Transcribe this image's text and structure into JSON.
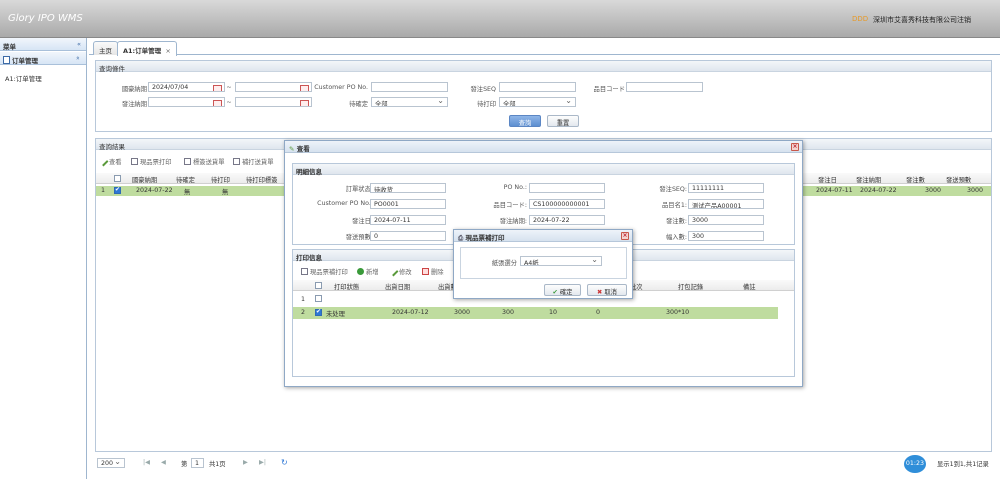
{
  "header": {
    "title": "Glory IPO WMS",
    "company": "深圳市艾喜秀科技有限公司",
    "logout": "注销",
    "dot": "DDD"
  },
  "sidebar": {
    "title": "菜单",
    "collapse": "«",
    "group": "订单管理",
    "group_toggle": "«",
    "link": "A1:订单管理"
  },
  "tabs": [
    {
      "label": "主页"
    },
    {
      "label": "A1:订单管理",
      "close": "×"
    }
  ],
  "query": {
    "title": "查询條件",
    "fields": {
      "order_date_label": "國豪納期",
      "order_date_from": "2024/07/04",
      "tilde1": "~",
      "po_label": "Customer PO No.",
      "seq_label": "發注SEQ",
      "item_code_label": "品目コード",
      "ship_date_label": "發注納期",
      "tilde2": "~",
      "confirm_label": "待確定",
      "confirm_value": "全部",
      "print_label": "待打印",
      "print_value": "全部"
    },
    "search_button": "查詢",
    "reset_button": "重置"
  },
  "results": {
    "title": "查詢結果",
    "toolbar": [
      "查看",
      "現品票打印",
      "標簽送貨單",
      "補打送貨單"
    ],
    "left_columns": [
      "國豪納期",
      "待確定",
      "待打印",
      "待打印標簽"
    ],
    "right_columns": [
      "發注日",
      "發注納期",
      "發注數",
      "發送預數"
    ],
    "row": {
      "num": "1",
      "date": "2024-07-22",
      "c1": "無",
      "c2": "無",
      "r1": "2024-07-11",
      "r2": "2024-07-22",
      "r3": "3000",
      "r4": "3000"
    }
  },
  "pager": {
    "size": "200",
    "page_label": "第",
    "page": "1",
    "total_label": "共1页",
    "info": "显示1到1,共1记录",
    "timer": "01:23"
  },
  "view_dialog": {
    "title": "查看",
    "detail_title": "明細信息",
    "labels": [
      "訂單状态:",
      "Customer PO No.:",
      "發注日:",
      "發送預數:",
      "PO No.:",
      "品目コード:",
      "發注納期:",
      "發注SEQ:",
      "品目名1:",
      "發注數:",
      "幅入數:"
    ],
    "values": {
      "status": "待收货",
      "customer_po": "PO0001",
      "order_date": "2024-07-11",
      "send_count": "0",
      "po_no": "",
      "item_code": "CS100000000001",
      "ship_date": "2024-07-22",
      "seq": "11111111",
      "item_name": "测试产品A00001",
      "qty": "3000",
      "box_qty": "300"
    },
    "print_title": "打印信息",
    "print_toolbar": [
      "現品票補打印",
      "新增",
      "修改",
      "删除"
    ],
    "print_columns": [
      "打印狀態",
      "出貨日期",
      "出貨數",
      "",
      "",
      "",
      "批次",
      "打包記錄",
      "備註"
    ],
    "print_rows": [
      {
        "num": "1",
        "status": "",
        "date": "",
        "qty": "",
        "c4": "",
        "c5": "",
        "c6": "",
        "batch": "",
        "record": "",
        "note": ""
      },
      {
        "num": "2",
        "status": "未处理",
        "date": "2024-07-12",
        "qty": "3000",
        "c4": "300",
        "c5": "10",
        "c6": "0",
        "batch": "",
        "record": "300*10",
        "note": ""
      }
    ]
  },
  "print_dialog": {
    "title": "現品票補打印",
    "paper_label": "紙張選分",
    "paper_value": "A4紙",
    "ok": "確定",
    "cancel": "取消"
  },
  "colors": {
    "accent": "#2f78d6",
    "selected_row": "#bfdc9f",
    "header_bg": "#b9b9b9"
  }
}
